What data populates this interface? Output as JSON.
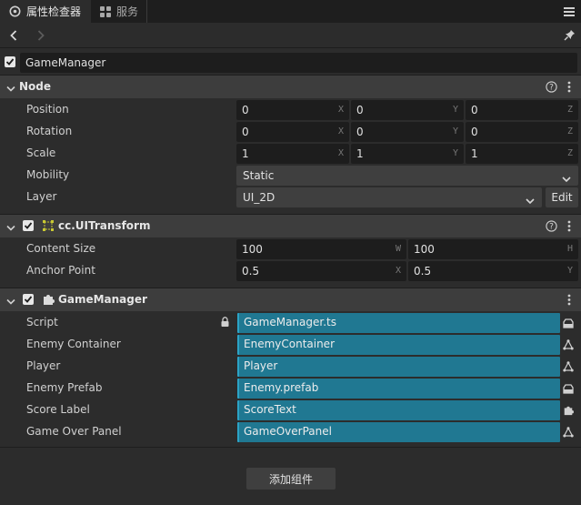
{
  "tabs": [
    {
      "label": "属性检查器",
      "icon": "inspector-icon"
    },
    {
      "label": "服务",
      "icon": "services-icon"
    }
  ],
  "node_name": "GameManager",
  "node_section": {
    "title": "Node",
    "props": {
      "position": {
        "label": "Position",
        "x": "0",
        "y": "0",
        "z": "0"
      },
      "rotation": {
        "label": "Rotation",
        "x": "0",
        "y": "0",
        "z": "0"
      },
      "scale": {
        "label": "Scale",
        "x": "1",
        "y": "1",
        "z": "1"
      },
      "mobility": {
        "label": "Mobility",
        "value": "Static"
      },
      "layer": {
        "label": "Layer",
        "value": "UI_2D",
        "edit_label": "Edit"
      }
    }
  },
  "uitransform": {
    "title": "cc.UITransform",
    "content_size": {
      "label": "Content Size",
      "w": "100",
      "h": "100"
    },
    "anchor_point": {
      "label": "Anchor Point",
      "x": "0.5",
      "y": "0.5"
    }
  },
  "gamemanager": {
    "title": "GameManager",
    "fields": [
      {
        "label": "Script",
        "value": "GameManager.ts"
      },
      {
        "label": "Enemy Container",
        "value": "EnemyContainer"
      },
      {
        "label": "Player",
        "value": "Player"
      },
      {
        "label": "Enemy Prefab",
        "value": "Enemy.prefab"
      },
      {
        "label": "Score Label",
        "value": "ScoreText"
      },
      {
        "label": "Game Over Panel",
        "value": "GameOverPanel"
      }
    ]
  },
  "axis_letters": {
    "x": "X",
    "y": "Y",
    "z": "Z",
    "w": "W",
    "h": "H"
  },
  "add_component_label": "添加组件",
  "colors": {
    "asset_field": "#207892",
    "section_header": "#3d3d3d",
    "background": "#2c2c2c"
  }
}
